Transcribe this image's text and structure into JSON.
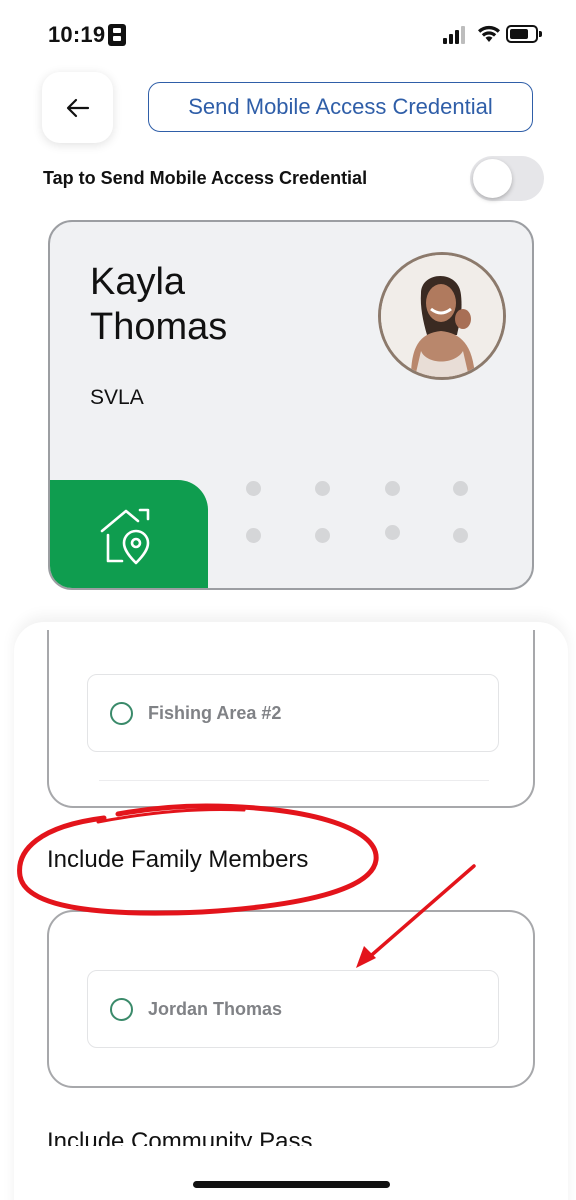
{
  "status_bar": {
    "time": "10:19"
  },
  "header": {
    "back_icon": "arrow-left-icon",
    "send_button_label": "Send Mobile Access Credential",
    "toggle_label": "Tap to Send Mobile Access Credential",
    "toggle_on": false
  },
  "card": {
    "first_name": "Kayla",
    "last_name": "Thomas",
    "organization": "SVLA",
    "badge_icon": "home-location-icon",
    "badge_color": "#0f9d4f"
  },
  "access_areas": {
    "items": [
      {
        "label": "Fishing Area #2",
        "selected": false
      }
    ]
  },
  "family": {
    "title": "Include Family Members",
    "items": [
      {
        "label": "Jordan Thomas",
        "selected": false
      }
    ]
  },
  "community": {
    "title": "Include Community Pass"
  },
  "colors": {
    "accent_blue": "#2f5ea8",
    "annotation_red": "#e3141b"
  }
}
